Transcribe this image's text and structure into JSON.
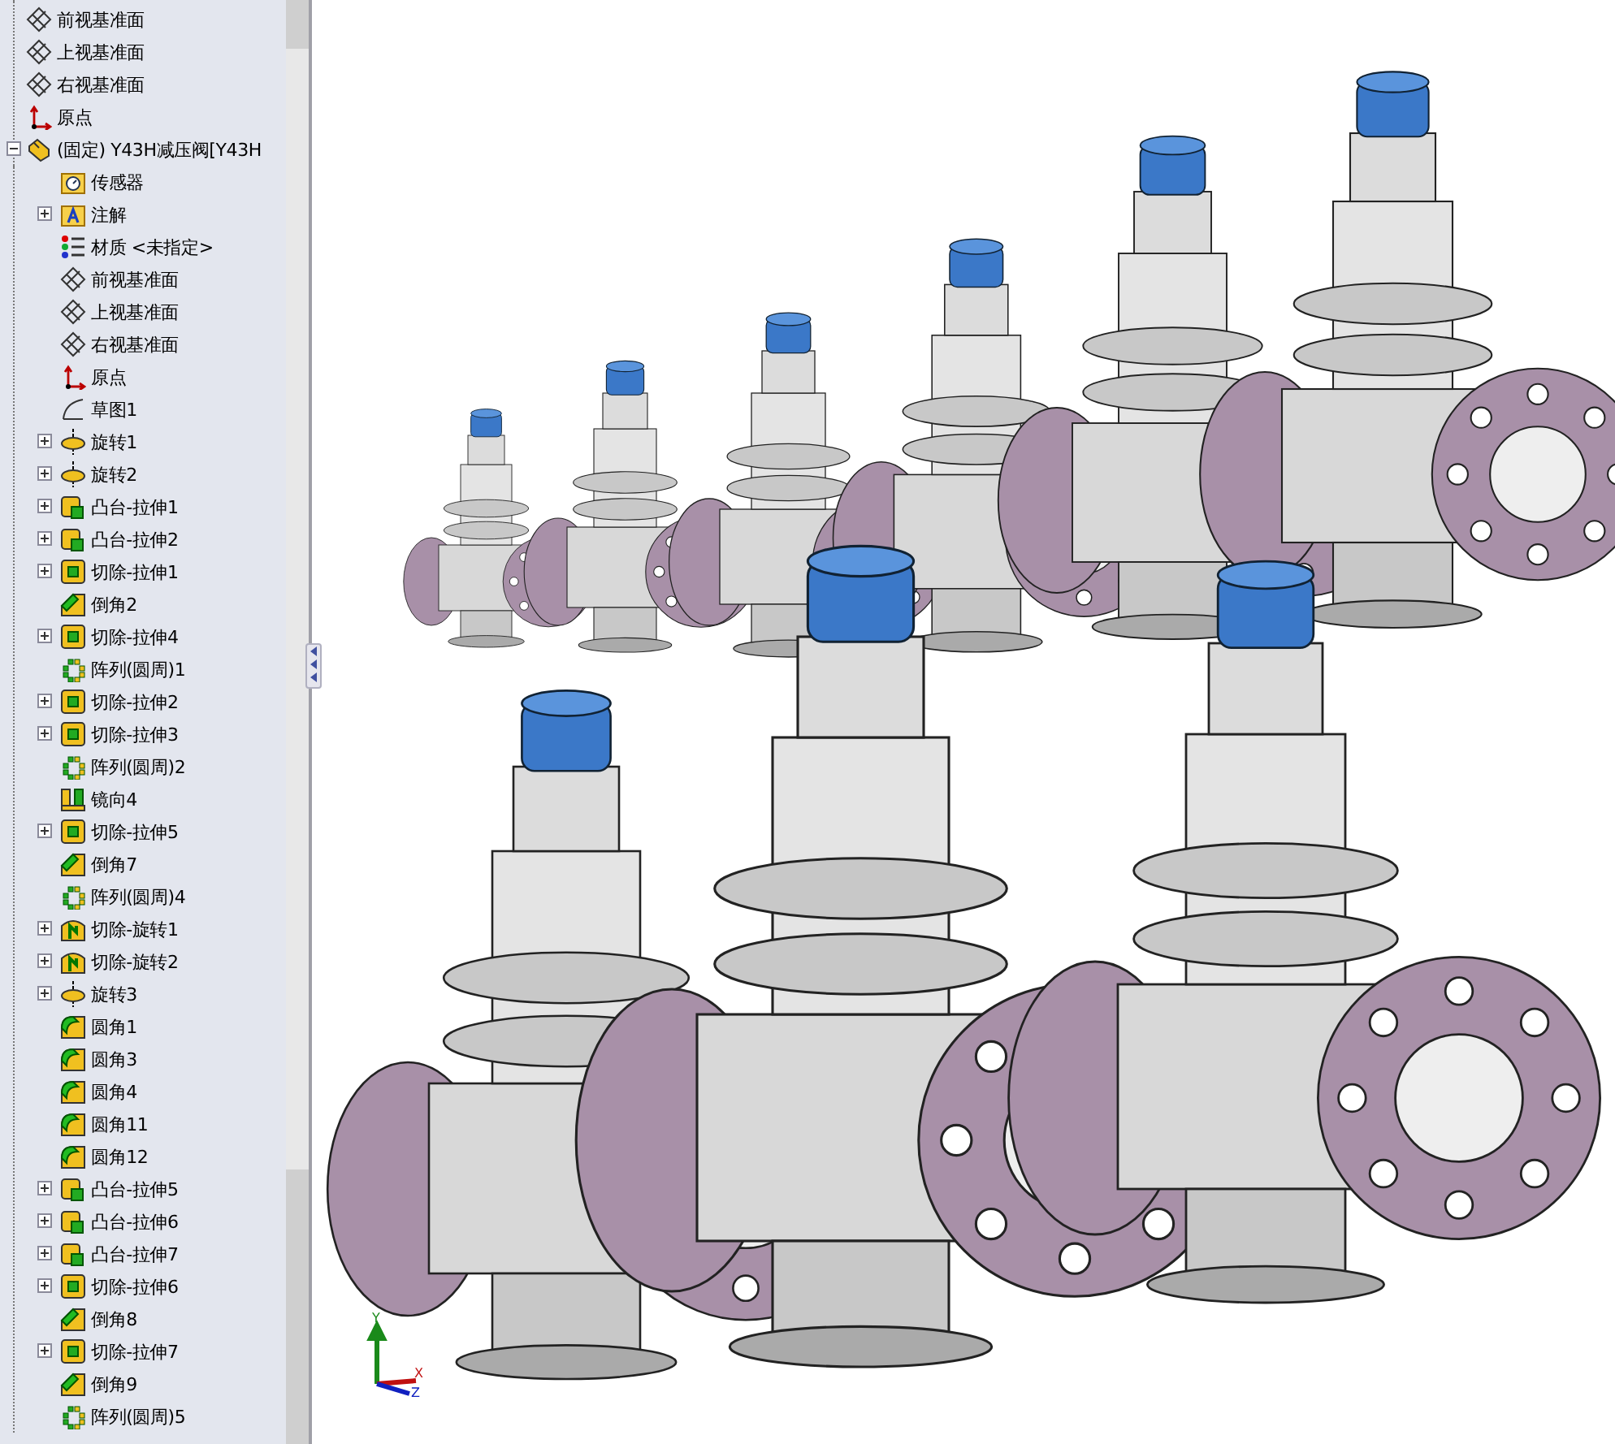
{
  "tree": [
    {
      "kind": "plane",
      "label": "前视基准面"
    },
    {
      "kind": "plane",
      "label": "上视基准面"
    },
    {
      "kind": "plane",
      "label": "右视基准面"
    },
    {
      "kind": "origin",
      "label": "原点"
    },
    {
      "kind": "part",
      "label": "(固定) Y43H减压阀[Y43H",
      "expanded": true,
      "children": [
        {
          "kind": "sensor",
          "label": "传感器"
        },
        {
          "kind": "annotation",
          "label": "注解",
          "expanded": false
        },
        {
          "kind": "material",
          "label": "材质 <未指定>"
        },
        {
          "kind": "plane",
          "label": "前视基准面"
        },
        {
          "kind": "plane",
          "label": "上视基准面"
        },
        {
          "kind": "plane",
          "label": "右视基准面"
        },
        {
          "kind": "origin",
          "label": "原点"
        },
        {
          "kind": "sketch",
          "label": "草图1"
        },
        {
          "kind": "revolve",
          "label": "旋转1",
          "expanded": false
        },
        {
          "kind": "revolve",
          "label": "旋转2",
          "expanded": false
        },
        {
          "kind": "boss",
          "label": "凸台-拉伸1",
          "expanded": false
        },
        {
          "kind": "boss",
          "label": "凸台-拉伸2",
          "expanded": false
        },
        {
          "kind": "cut",
          "label": "切除-拉伸1",
          "expanded": false
        },
        {
          "kind": "chamfer",
          "label": "倒角2"
        },
        {
          "kind": "cut",
          "label": "切除-拉伸4",
          "expanded": false
        },
        {
          "kind": "pattern",
          "label": "阵列(圆周)1"
        },
        {
          "kind": "cut",
          "label": "切除-拉伸2",
          "expanded": false
        },
        {
          "kind": "cut",
          "label": "切除-拉伸3",
          "expanded": false
        },
        {
          "kind": "pattern",
          "label": "阵列(圆周)2"
        },
        {
          "kind": "mirror",
          "label": "镜向4"
        },
        {
          "kind": "cut",
          "label": "切除-拉伸5",
          "expanded": false
        },
        {
          "kind": "chamfer",
          "label": "倒角7"
        },
        {
          "kind": "pattern",
          "label": "阵列(圆周)4"
        },
        {
          "kind": "cutrevolve",
          "label": "切除-旋转1",
          "expanded": false
        },
        {
          "kind": "cutrevolve",
          "label": "切除-旋转2",
          "expanded": false
        },
        {
          "kind": "revolve",
          "label": "旋转3",
          "expanded": false
        },
        {
          "kind": "fillet",
          "label": "圆角1"
        },
        {
          "kind": "fillet",
          "label": "圆角3"
        },
        {
          "kind": "fillet",
          "label": "圆角4"
        },
        {
          "kind": "fillet",
          "label": "圆角11"
        },
        {
          "kind": "fillet",
          "label": "圆角12"
        },
        {
          "kind": "boss",
          "label": "凸台-拉伸5",
          "expanded": false
        },
        {
          "kind": "boss",
          "label": "凸台-拉伸6",
          "expanded": false
        },
        {
          "kind": "boss",
          "label": "凸台-拉伸7",
          "expanded": false
        },
        {
          "kind": "cut",
          "label": "切除-拉伸6",
          "expanded": false
        },
        {
          "kind": "chamfer",
          "label": "倒角8"
        },
        {
          "kind": "cut",
          "label": "切除-拉伸7",
          "expanded": false
        },
        {
          "kind": "chamfer",
          "label": "倒角9"
        },
        {
          "kind": "pattern",
          "label": "阵列(圆周)5"
        }
      ]
    }
  ],
  "triad": {
    "x_label": "X",
    "y_label": "Y",
    "z_label": "Z"
  }
}
